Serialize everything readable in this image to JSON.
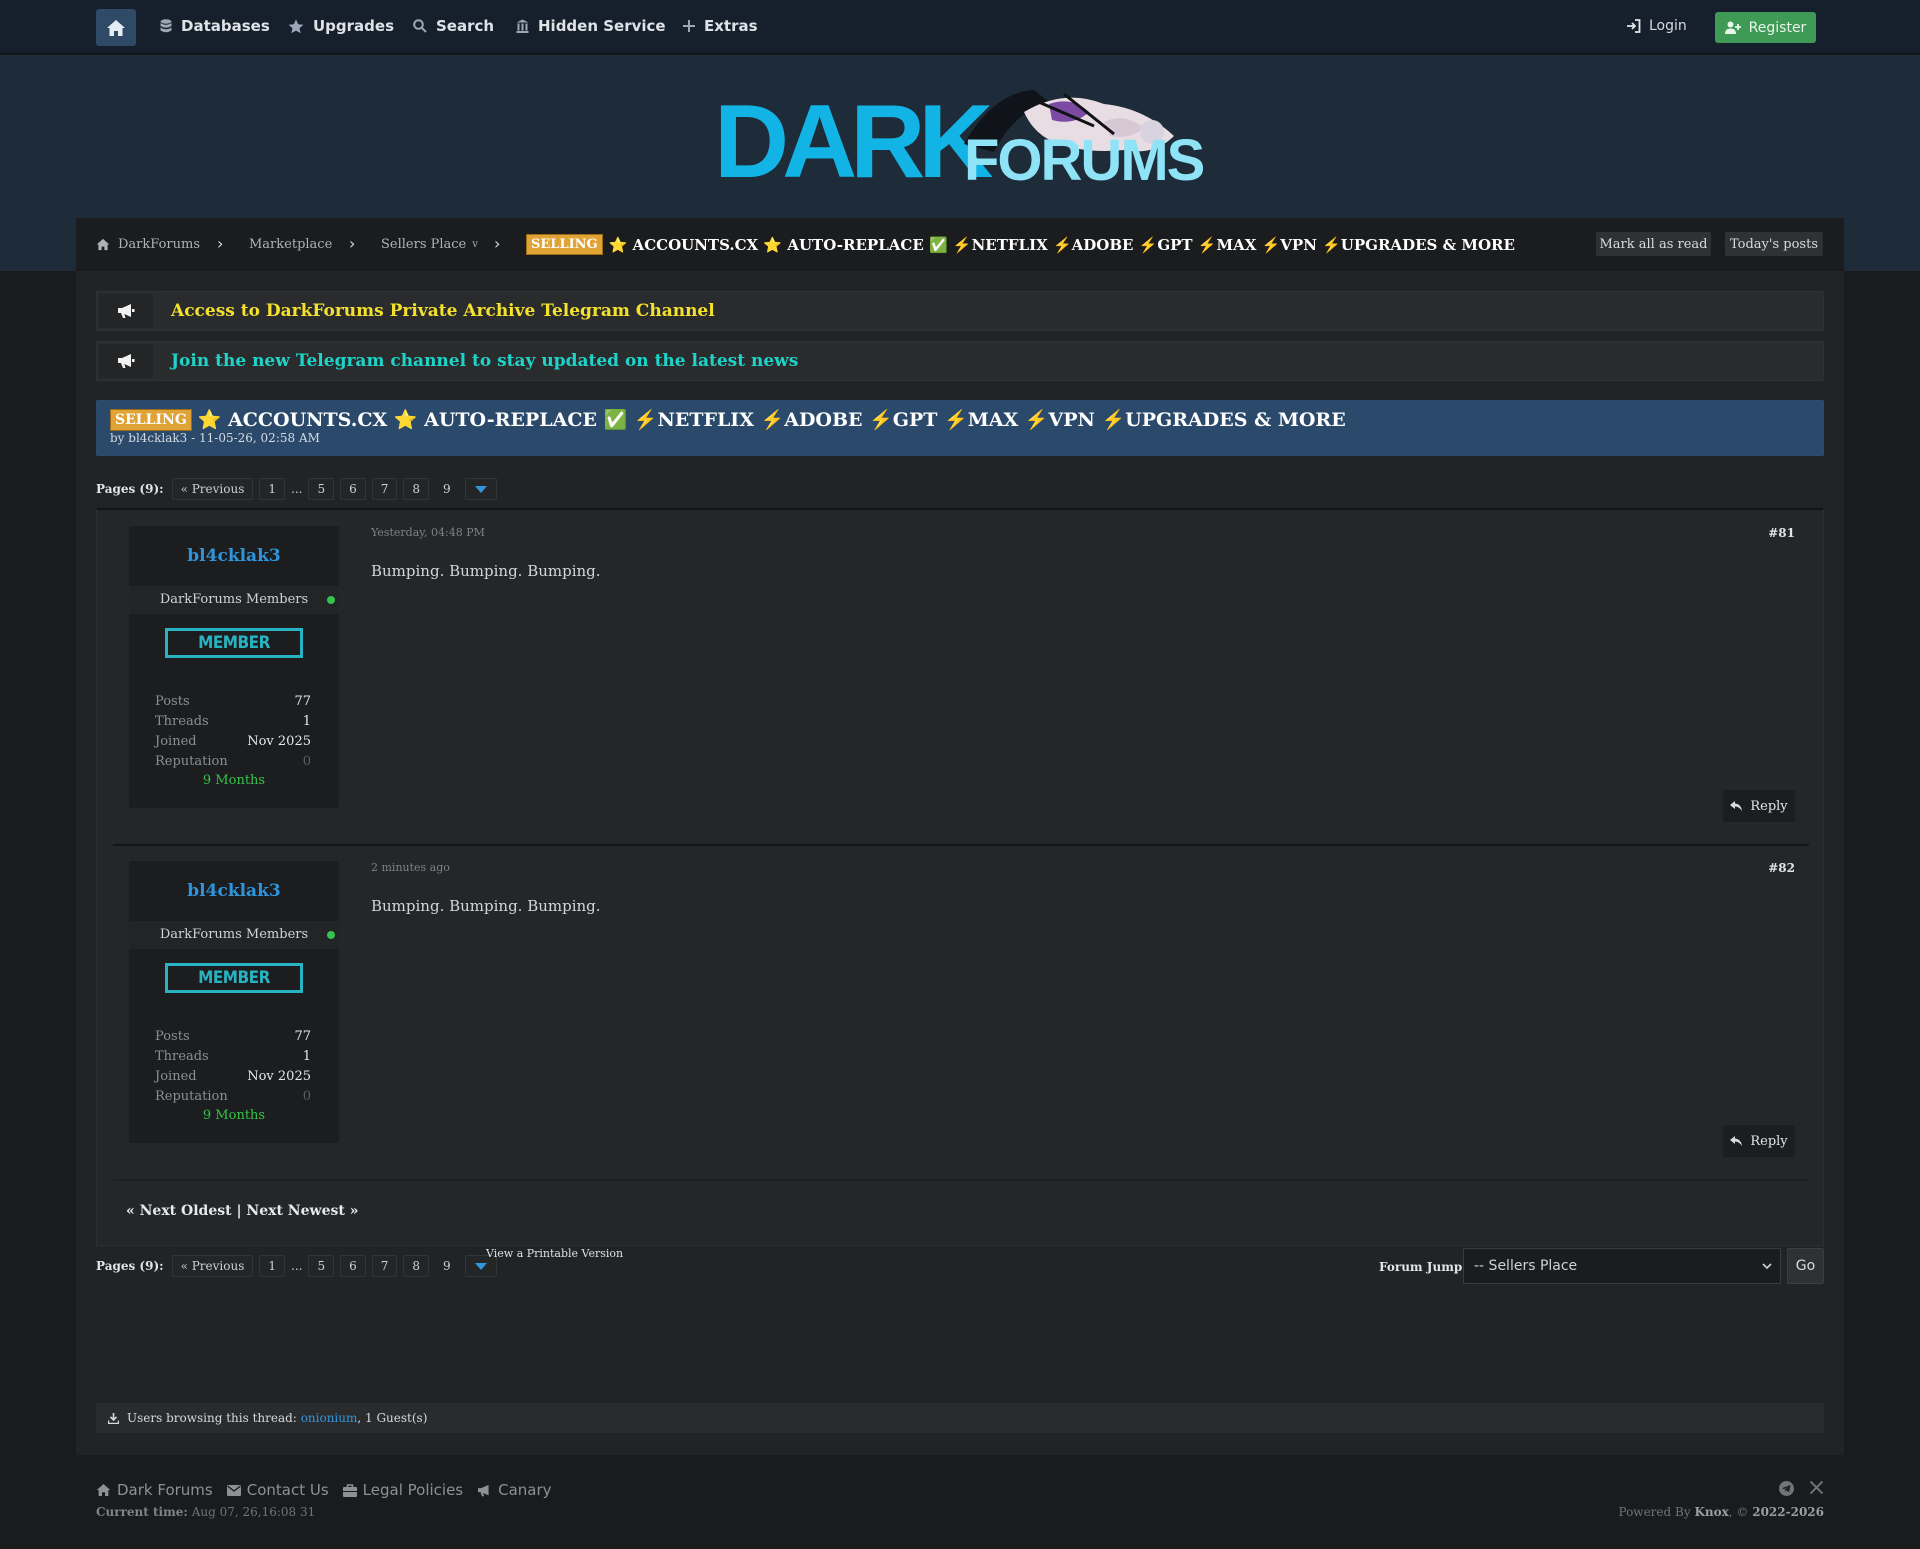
{
  "nav": {
    "items": [
      "Databases",
      "Upgrades",
      "Search",
      "Hidden Service",
      "Extras"
    ],
    "login": "Login",
    "register": "Register"
  },
  "logo": {
    "dark": "DARK",
    "forums": "FORUMS"
  },
  "breadcrumb": {
    "items": [
      "DarkForums",
      "Marketplace",
      "Sellers Place"
    ],
    "dropdown_marker": "v",
    "current_tag": "SELLING",
    "current_title": "⭐ ACCOUNTS.CX ⭐ AUTO-REPLACE ✅ ⚡NETFLIX ⚡ADOBE ⚡GPT ⚡MAX ⚡VPN ⚡UPGRADES & MORE",
    "mark_read": "Mark all as read",
    "todays_posts": "Today's posts"
  },
  "announcements": [
    {
      "text": "Access to DarkForums Private Archive Telegram Channel",
      "color": "#f3e12d"
    },
    {
      "text": "Join the new Telegram channel to stay updated on the latest news",
      "color": "#1ed3c8"
    }
  ],
  "thread": {
    "tag": "SELLING",
    "title": "⭐ ACCOUNTS.CX ⭐ AUTO-REPLACE ✅ ⚡NETFLIX ⚡ADOBE ⚡GPT ⚡MAX ⚡VPN ⚡UPGRADES & MORE",
    "byline": "by bl4cklak3 - 11-05-26, 02:58 AM"
  },
  "pagination": {
    "label": "Pages (9):",
    "previous": "« Previous",
    "pages": [
      "1",
      "5",
      "6",
      "7",
      "8"
    ],
    "ellipsis": "...",
    "current": "9"
  },
  "posts": [
    {
      "username": "bl4cklak3",
      "group": "DarkForums Members",
      "badge": "MEMBER",
      "stats": {
        "posts_label": "Posts",
        "posts": "77",
        "threads_label": "Threads",
        "threads": "1",
        "joined_label": "Joined",
        "joined": "Nov 2025",
        "rep_label": "Reputation",
        "rep": "0"
      },
      "membership": "9 Months",
      "date": "Yesterday, 04:48 PM",
      "number": "#81",
      "body": "Bumping. Bumping. Bumping.",
      "reply": "Reply"
    },
    {
      "username": "bl4cklak3",
      "group": "DarkForums Members",
      "badge": "MEMBER",
      "stats": {
        "posts_label": "Posts",
        "posts": "77",
        "threads_label": "Threads",
        "threads": "1",
        "joined_label": "Joined",
        "joined": "Nov 2025",
        "rep_label": "Reputation",
        "rep": "0"
      },
      "membership": "9 Months",
      "date": "2 minutes ago",
      "number": "#82",
      "body": "Bumping. Bumping. Bumping.",
      "reply": "Reply"
    }
  ],
  "thread_nav": "« Next Oldest | Next Newest »",
  "printable": "View a Printable Version",
  "forum_jump": {
    "label": "Forum Jump:",
    "selected": "-- Sellers Place",
    "go": "Go"
  },
  "browsing": {
    "prefix": "Users browsing this thread:",
    "user": "onionium",
    "suffix": ", 1 Guest(s)"
  },
  "footer": {
    "links": [
      "Dark Forums",
      "Contact Us",
      "Legal Policies",
      "Canary"
    ],
    "current_time_label": "Current time:",
    "current_time": "Aug 07, 26,16:08 31",
    "powered_prefix": "Powered By",
    "powered_name": "Knox",
    "powered_suffix": ", ©",
    "years": "2022-2026"
  },
  "colors": {
    "accent": "#2e95dd",
    "online": "#35c24d",
    "selling_tag": "#e0a336",
    "register": "#3f9a55"
  },
  "icons": [
    "home-icon",
    "database-icon",
    "star-icon",
    "search-icon",
    "building-icon",
    "plus-icon",
    "login-icon",
    "user-plus-icon",
    "megaphone-icon",
    "chevron-down-icon",
    "reply-icon",
    "download-icon",
    "envelope-icon",
    "briefcase-icon",
    "telegram-icon",
    "x-icon"
  ]
}
